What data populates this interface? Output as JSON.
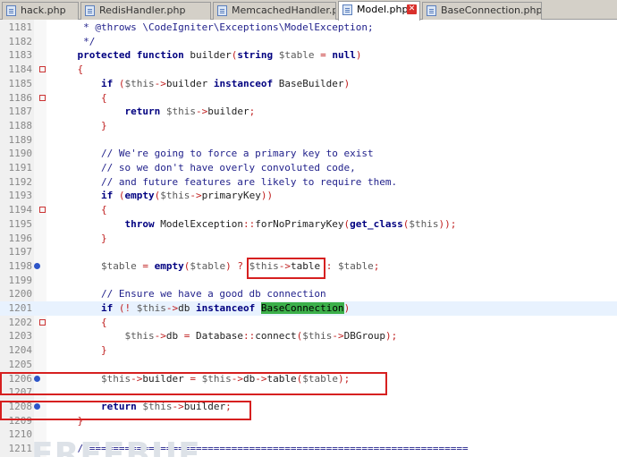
{
  "tabs": [
    {
      "label": "hack.php",
      "active": false
    },
    {
      "label": "RedisHandler.php",
      "active": false
    },
    {
      "label": "MemcachedHandler.php",
      "active": false
    },
    {
      "label": "Model.php",
      "active": true
    },
    {
      "label": "BaseConnection.php",
      "active": false
    }
  ],
  "lines": [
    {
      "n": "1181",
      "text": "     * @throws \\CodeIgniter\\Exceptions\\ModelException;"
    },
    {
      "n": "1182",
      "text": "     */"
    },
    {
      "n": "1183",
      "text": "    protected function builder(string $table = null)"
    },
    {
      "n": "1184",
      "text": "    {"
    },
    {
      "n": "1185",
      "text": "        if ($this->builder instanceof BaseBuilder)"
    },
    {
      "n": "1186",
      "text": "        {"
    },
    {
      "n": "1187",
      "text": "            return $this->builder;"
    },
    {
      "n": "1188",
      "text": "        }"
    },
    {
      "n": "1189",
      "text": ""
    },
    {
      "n": "1190",
      "text": "        // We're going to force a primary key to exist"
    },
    {
      "n": "1191",
      "text": "        // so we don't have overly convoluted code,"
    },
    {
      "n": "1192",
      "text": "        // and future features are likely to require them."
    },
    {
      "n": "1193",
      "text": "        if (empty($this->primaryKey))"
    },
    {
      "n": "1194",
      "text": "        {"
    },
    {
      "n": "1195",
      "text": "            throw ModelException::forNoPrimaryKey(get_class($this));"
    },
    {
      "n": "1196",
      "text": "        }"
    },
    {
      "n": "1197",
      "text": ""
    },
    {
      "n": "1198",
      "text": "        $table = empty($table) ? $this->table : $table;"
    },
    {
      "n": "1199",
      "text": ""
    },
    {
      "n": "1200",
      "text": "        // Ensure we have a good db connection"
    },
    {
      "n": "1201",
      "text": "        if (! $this->db instanceof BaseConnection)"
    },
    {
      "n": "1202",
      "text": "        {"
    },
    {
      "n": "1203",
      "text": "            $this->db = Database::connect($this->DBGroup);"
    },
    {
      "n": "1204",
      "text": "        }"
    },
    {
      "n": "1205",
      "text": ""
    },
    {
      "n": "1206",
      "text": "        $this->builder = $this->db->table($table);"
    },
    {
      "n": "1207",
      "text": ""
    },
    {
      "n": "1208",
      "text": "        return $this->builder;"
    },
    {
      "n": "1209",
      "text": "    }"
    },
    {
      "n": "1210",
      "text": ""
    },
    {
      "n": "1211",
      "text": "    //================================================================"
    }
  ],
  "watermark": "FREEBUF",
  "colors": {
    "keyword": "#000080",
    "comment": "#1f1f8a",
    "variable": "#5a5a5a",
    "operator": "#c02020",
    "highlight": "#3cb04a",
    "annotation_box": "#d62020",
    "breakpoint": "#2d55c8"
  }
}
